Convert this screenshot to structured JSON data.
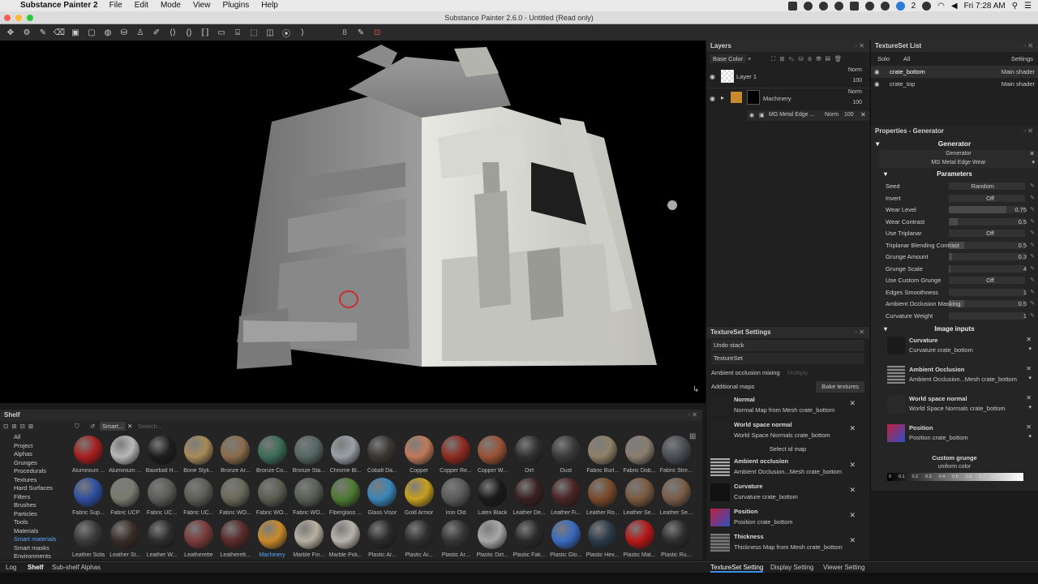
{
  "menubar": {
    "app": "Substance Painter 2",
    "items": [
      "File",
      "Edit",
      "Mode",
      "View",
      "Plugins",
      "Help"
    ],
    "status_count": "2",
    "clock": "Fri 7:28 AM"
  },
  "window": {
    "title": "Substance Painter 2.6.0 - Untitled (Read only)"
  },
  "toolbar": {
    "brush_size": "8"
  },
  "layers": {
    "title": "Layers",
    "channel": "Base Color",
    "items": [
      {
        "name": "Layer 1",
        "blend": "Norm",
        "opacity": "100"
      },
      {
        "name": "Machinery",
        "blend": "Norm",
        "opacity": "100"
      }
    ],
    "effect": {
      "name": "MG Metal Edge ...",
      "blend": "Norm",
      "opacity": "100"
    }
  },
  "texture_set_list": {
    "title": "TextureSet List",
    "solo": "Solo",
    "all": "All",
    "settings": "Settings",
    "items": [
      {
        "name": "crate_bottom",
        "shader": "Main shader"
      },
      {
        "name": "crate_top",
        "shader": "Main shader"
      }
    ]
  },
  "properties": {
    "title": "Properties - Generator",
    "section": "Generator",
    "generator_label": "Generator",
    "generator_name": "MG Metal Edge Wear",
    "parameters_label": "Parameters",
    "params": [
      {
        "name": "Seed",
        "value": "Random",
        "fill": 0
      },
      {
        "name": "Invert",
        "value": "Off",
        "fill": 0
      },
      {
        "name": "Wear Level",
        "value": "0.75",
        "fill": 0.75
      },
      {
        "name": "Wear Contrast",
        "value": "0.5",
        "fill": 0.12
      },
      {
        "name": "Use Triplanar",
        "value": "Off",
        "fill": 0
      },
      {
        "name": "Triplanar Blending Contrast",
        "value": "0.5",
        "fill": 0.2
      },
      {
        "name": "Grunge Amount",
        "value": "0.3",
        "fill": 0.04
      },
      {
        "name": "Grunge Scale",
        "value": "4",
        "fill": 0.02
      },
      {
        "name": "Use Custom Grunge",
        "value": "Off",
        "fill": 0
      },
      {
        "name": "Edges Smoothness",
        "value": "1",
        "fill": 0.0
      },
      {
        "name": "Ambient Occlusion Masking",
        "value": "0.5",
        "fill": 0.2
      },
      {
        "name": "Curvature Weight",
        "value": "1",
        "fill": 0.0
      }
    ],
    "image_inputs_label": "Image inputs",
    "inputs": [
      {
        "name": "Curvature",
        "map": "Curvature crate_bottom"
      },
      {
        "name": "Ambient Occlusion",
        "map": "Ambient Occlusion...Mesh crate_bottom"
      },
      {
        "name": "World space normal",
        "map": "World Space Normals crate_bottom"
      },
      {
        "name": "Position",
        "map": "Position crate_bottom"
      }
    ],
    "custom_grunge": {
      "label": "Custom grunge",
      "value": "uniform color"
    },
    "slider_ticks": [
      "0",
      "0.1",
      "0.2",
      "0.3",
      "0.4",
      "0.5",
      "0.6",
      "0.7",
      "0.8",
      "0.9",
      "1"
    ]
  },
  "texture_set_settings": {
    "title": "TextureSet Settings",
    "undo": "Undo stack",
    "textureset": "TextureSet",
    "ao_mixing_label": "Ambient occlusion mixing",
    "ao_mixing_value": "Multiply",
    "additional_maps": "Additional maps",
    "bake": "Bake textures",
    "maps": [
      {
        "name": "Normal",
        "map": "Normal Map from Mesh crate_bottom"
      },
      {
        "name": "World space normal",
        "map": "World Space Normals crate_bottom"
      }
    ],
    "select_id": "Select id map",
    "maps2": [
      {
        "name": "Ambient occlusion",
        "map": "Ambient Occlusion...Mesh crate_bottom"
      },
      {
        "name": "Curvature",
        "map": "Curvature crate_bottom"
      },
      {
        "name": "Position",
        "map": "Position crate_bottom"
      },
      {
        "name": "Thickness",
        "map": "Thickness Map from Mesh crate_bottom"
      }
    ]
  },
  "shelf": {
    "title": "Shelf",
    "filter": "Smart...",
    "search_placeholder": "Search...",
    "categories": [
      "All",
      "Project",
      "Alphas",
      "Grunges",
      "Procedurals",
      "Textures",
      "Hard Surfaces",
      "Filters",
      "Brushes",
      "Particles",
      "Tools",
      "Materials",
      "Smart materials",
      "Smart masks",
      "Environments"
    ],
    "materials": [
      [
        "Aluminium ...",
        "Aluminium ...",
        "Baseball H...",
        "Bone Styli...",
        "Bronze Ar...",
        "Bronze Co...",
        "Bronze Sta...",
        "Chrome Bl...",
        "Cobalt Da...",
        "Copper",
        "Copper Re...",
        "Copper W...",
        "Dirt",
        "Dust",
        "Fabric Burl...",
        "Fabric Dob...",
        "Fabric Stre..."
      ],
      [
        "Fabric Sup...",
        "Fabric UCP",
        "Fabric UC...",
        "Fabric UC...",
        "Fabric WO...",
        "Fabric WO...",
        "Fabric WO...",
        "Fiberglass ...",
        "Glass Visor",
        "Gold Armor",
        "Iron Old",
        "Latex Black",
        "Leather De...",
        "Leather Fi...",
        "Leather Ro...",
        "Leather Se...",
        "Leather Se..."
      ],
      [
        "Leather Sofa",
        "Leather St...",
        "Leather W...",
        "Leatherette",
        "Leatherett...",
        "Machinery",
        "Marble Fin...",
        "Marble Poli...",
        "Plastic Ar...",
        "Plastic Ar...",
        "Plastic Ar...",
        "Plastic Dirt...",
        "Plastic Fak...",
        "Plastic Glo...",
        "Plastic Hex...",
        "Plastic Mat...",
        "Plastic Ru..."
      ]
    ],
    "colors": [
      [
        "#a81e1e",
        "#b8b8b8",
        "#1d1d1d",
        "#a88a5a",
        "#8a6d4c",
        "#3b6b58",
        "#556663",
        "#9aa0a8",
        "#3a3632",
        "#c07a5a",
        "#8e2b20",
        "#9a5234",
        "#2f2f2f",
        "#3a3a3a",
        "#8f8068",
        "#8a7e70",
        "#4a4f55"
      ],
      [
        "#2f4fa0",
        "#7a7a6e",
        "#5b5b58",
        "#5d5d55",
        "#6a6a5a",
        "#5a5e50",
        "#585f55",
        "#4e7a32",
        "#3a86b8",
        "#c8a020",
        "#5a5a5a",
        "#1a1a1a",
        "#3a2020",
        "#4a2424",
        "#7a4a2a",
        "#7a5a40",
        "#7a5e48"
      ],
      [
        "#3a3a3a",
        "#3a2c26",
        "#2c2c2c",
        "#7a3a3a",
        "#5a2a2a",
        "#c88a2a",
        "#b8b0a0",
        "#b8b4ac",
        "#2a2a2a",
        "#2e2e2e",
        "#353535",
        "#a8a8a8",
        "#2a2a2a",
        "#3a6ac0",
        "#2a3a48",
        "#b81818",
        "#2c2c2c"
      ]
    ]
  },
  "status": {
    "tabs": [
      "Log",
      "Shelf",
      "Sub-shelf Alphas"
    ],
    "right_tabs": [
      "TextureSet Setting",
      "Display Setting",
      "Viewer Setting"
    ]
  }
}
